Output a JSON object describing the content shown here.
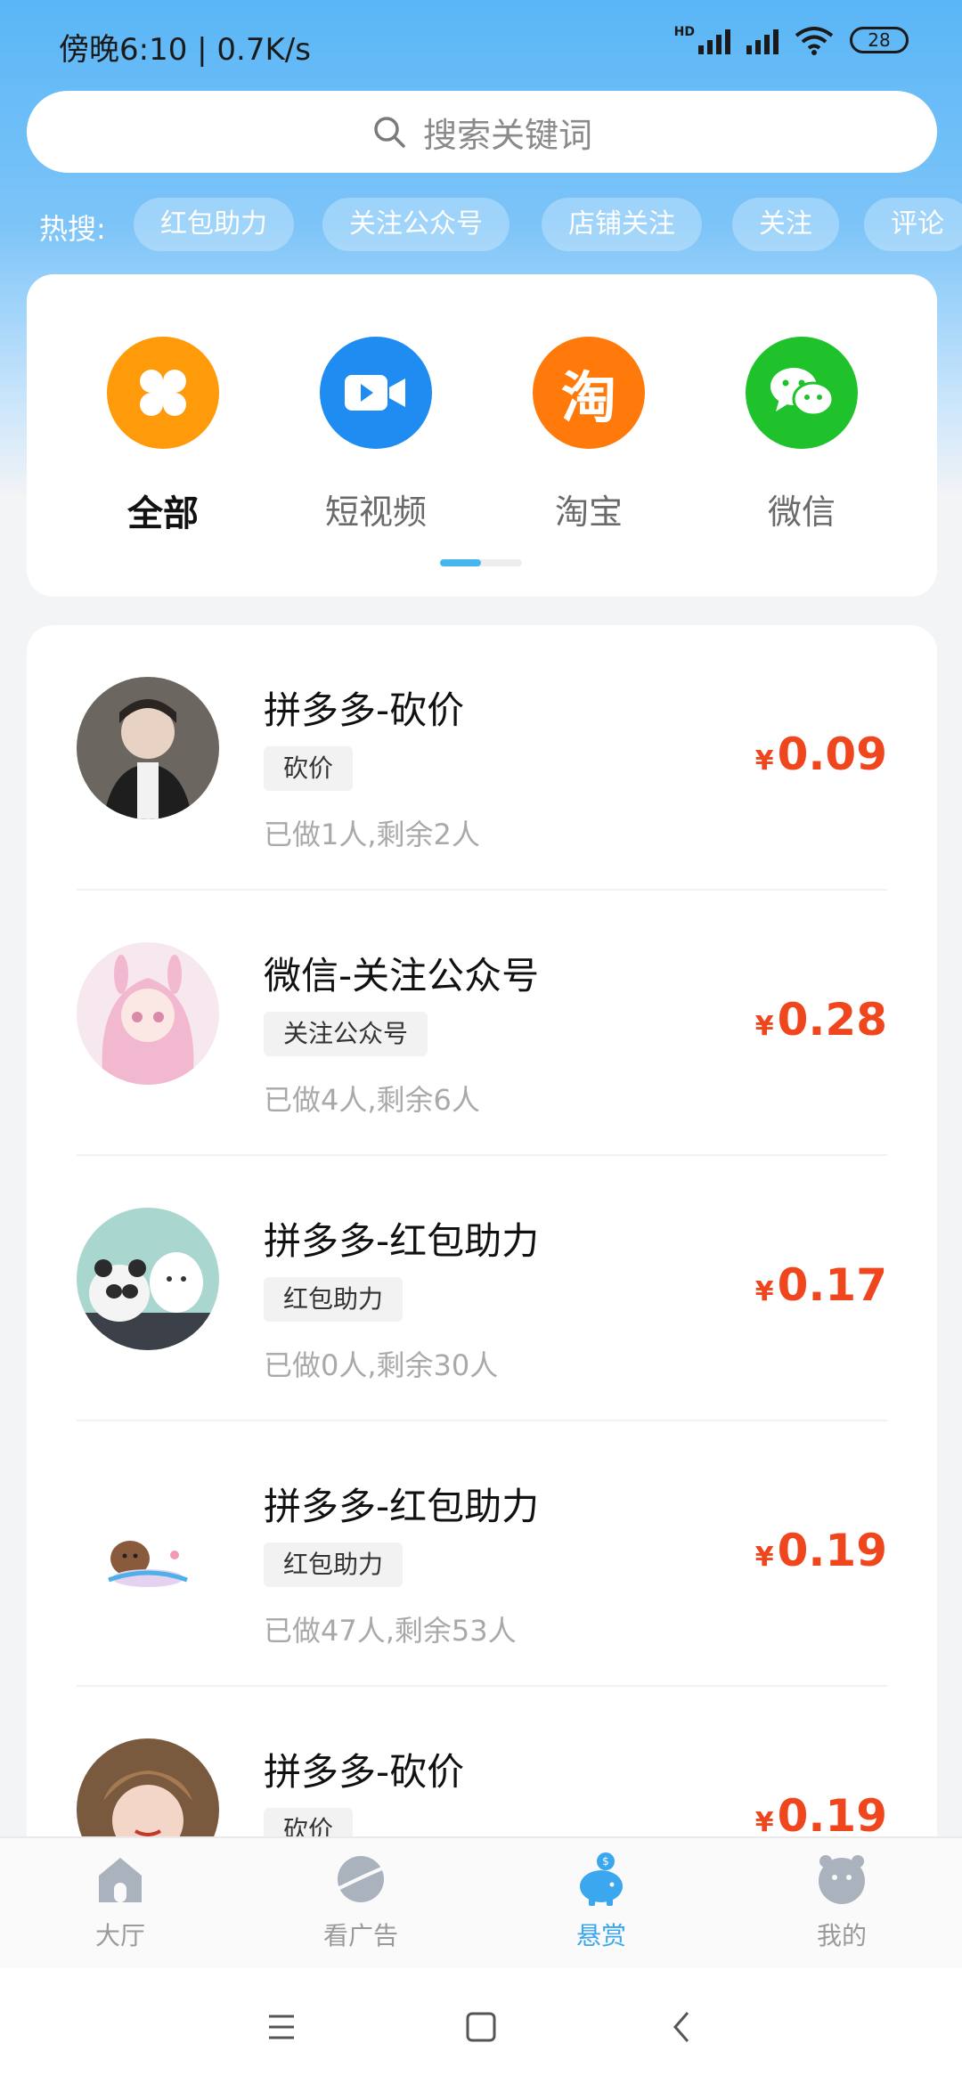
{
  "status_bar": {
    "time_speed": "傍晚6:10 | 0.7K/s",
    "hd_label": "HD",
    "battery": "28"
  },
  "search": {
    "placeholder": "搜索关键词"
  },
  "hot_search": {
    "label": "热搜:",
    "tags": [
      "红包助力",
      "关注公众号",
      "店铺关注",
      "关注",
      "评论"
    ]
  },
  "categories": [
    {
      "label": "全部",
      "icon": "clover-icon",
      "color": "#ff9a0a",
      "active": true
    },
    {
      "label": "短视频",
      "icon": "video-camera-icon",
      "color": "#1e8cf0",
      "active": false
    },
    {
      "label": "淘宝",
      "icon": "taobao-icon",
      "glyph": "淘",
      "color": "#ff7a0a",
      "active": false
    },
    {
      "label": "微信",
      "icon": "wechat-icon",
      "color": "#1fc22b",
      "active": false
    }
  ],
  "tasks": [
    {
      "title": "拼多多-砍价",
      "tag": "砍价",
      "meta": "已做1人,剩余2人",
      "currency": "¥",
      "price": "0.09"
    },
    {
      "title": "微信-关注公众号",
      "tag": "关注公众号",
      "meta": "已做4人,剩余6人",
      "currency": "¥",
      "price": "0.28"
    },
    {
      "title": "拼多多-红包助力",
      "tag": "红包助力",
      "meta": "已做0人,剩余30人",
      "currency": "¥",
      "price": "0.17"
    },
    {
      "title": "拼多多-红包助力",
      "tag": "红包助力",
      "meta": "已做47人,剩余53人",
      "currency": "¥",
      "price": "0.19"
    },
    {
      "title": "拼多多-砍价",
      "tag": "砍价",
      "meta": "",
      "currency": "¥",
      "price": "0.19"
    }
  ],
  "tabbar": [
    {
      "label": "大厅",
      "icon": "house-icon",
      "active": false
    },
    {
      "label": "看广告",
      "icon": "planet-icon",
      "active": false
    },
    {
      "label": "悬赏",
      "icon": "piggy-bank-icon",
      "active": true
    },
    {
      "label": "我的",
      "icon": "face-icon",
      "active": false
    }
  ],
  "colors": {
    "accent": "#3aa7ee",
    "price": "#f0461e",
    "header_gradient_top": "#5ab6f6"
  }
}
